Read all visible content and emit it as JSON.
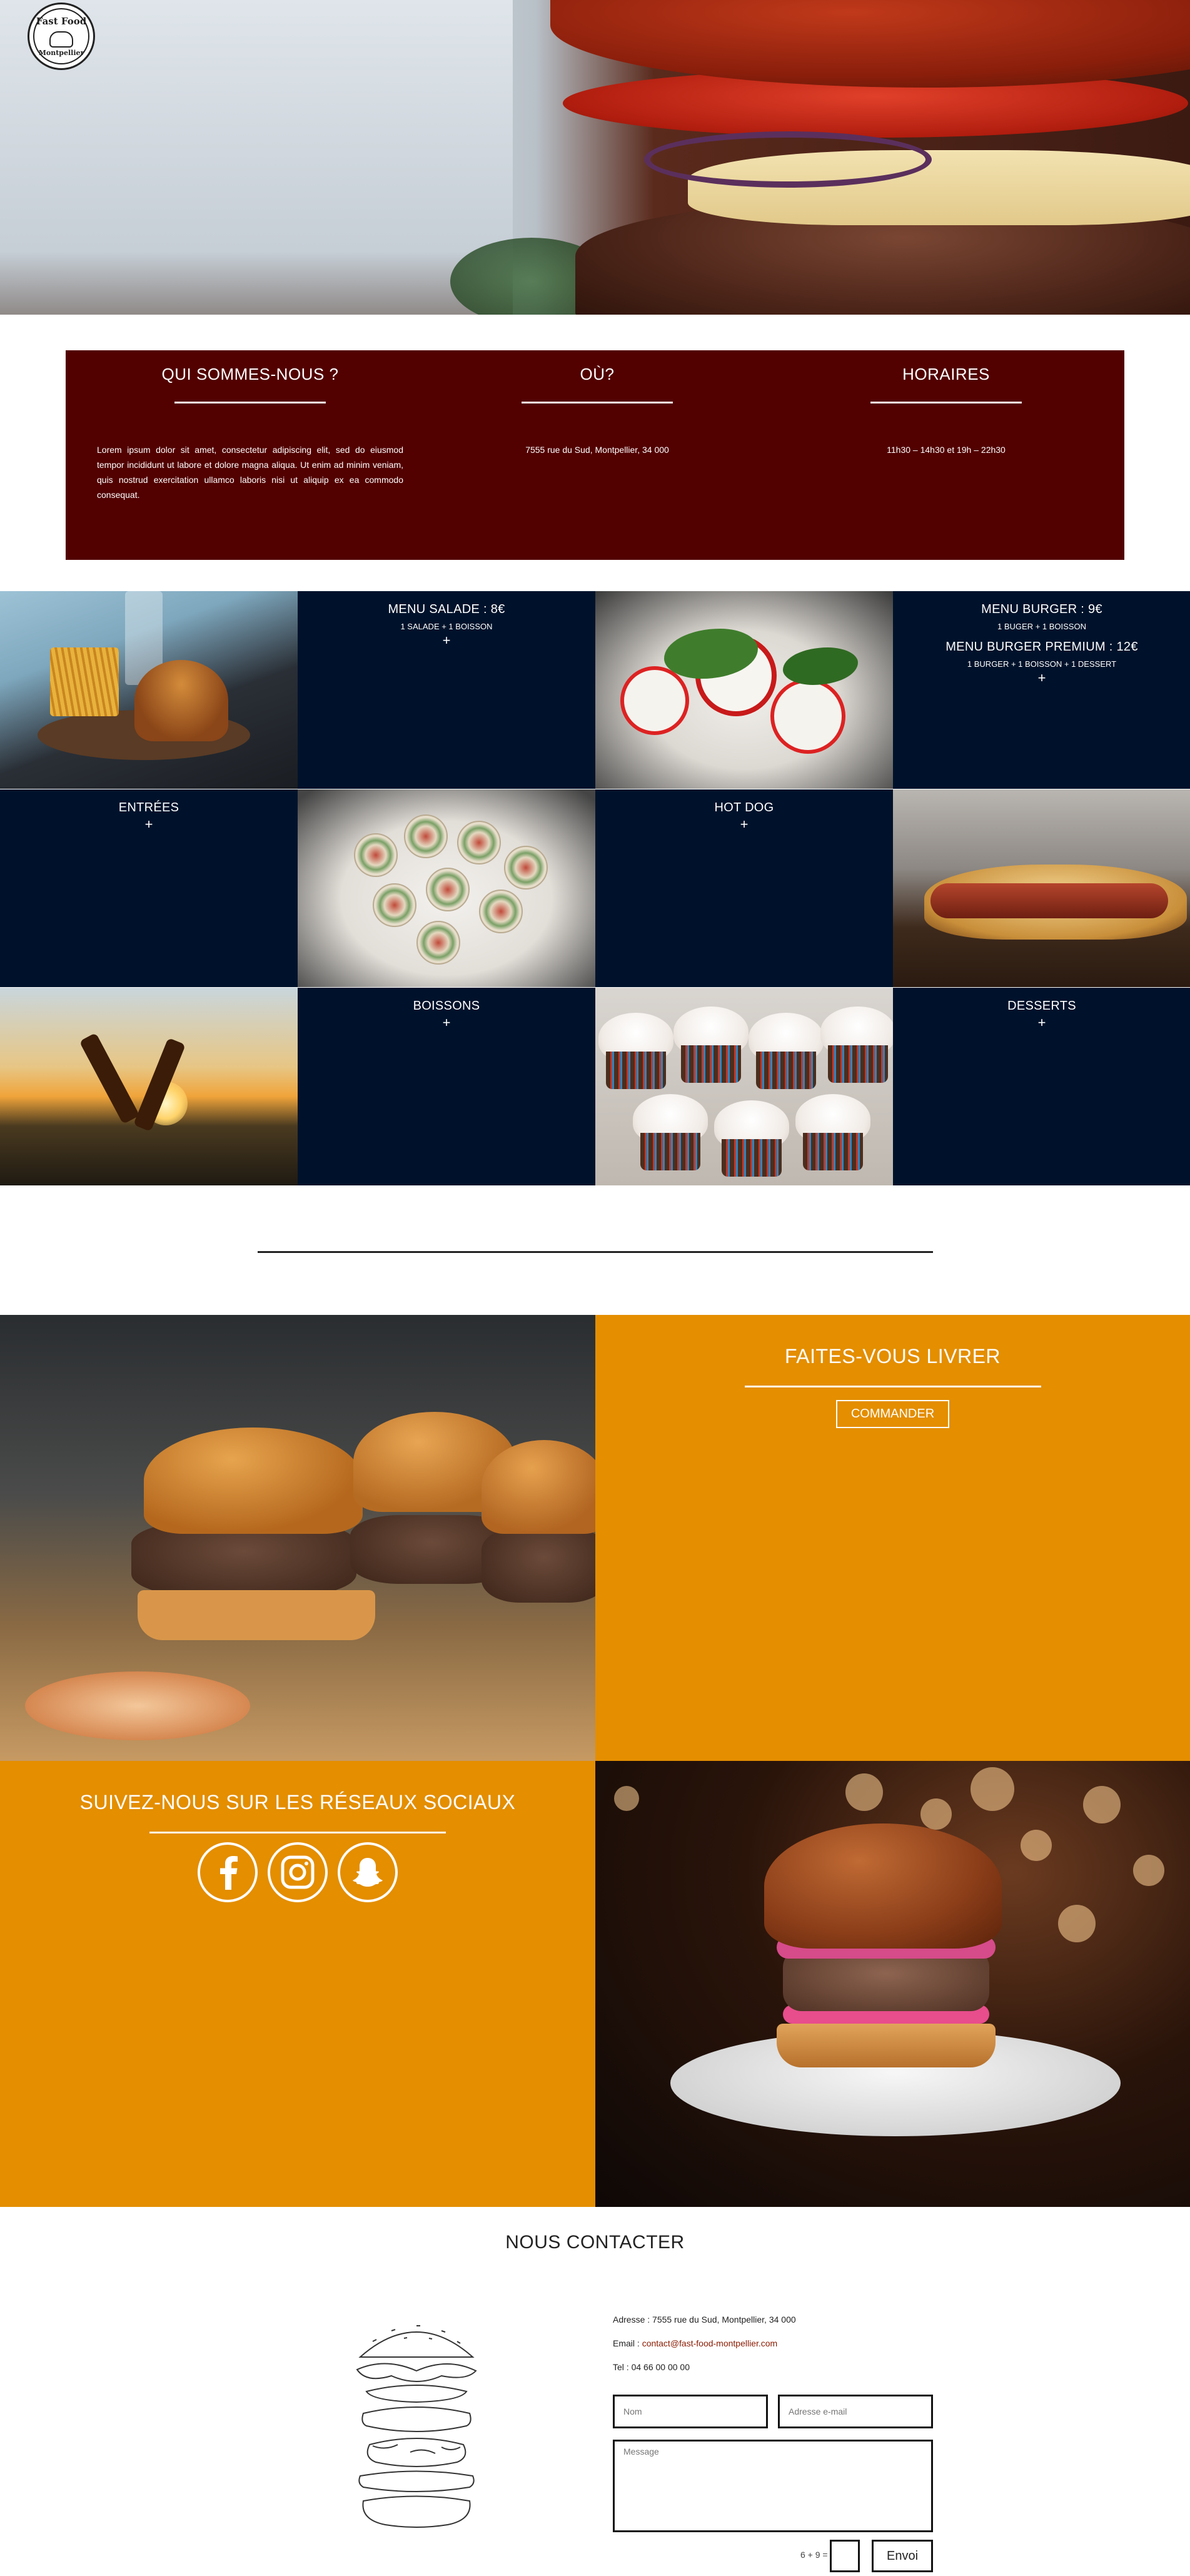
{
  "logo": {
    "line1": "Fast Food",
    "line2": "Montpellier"
  },
  "info": {
    "about": {
      "title": "QUI SOMMES-NOUS ?",
      "text": "Lorem ipsum dolor sit amet, consectetur adipiscing elit, sed do eiusmod tempor incididunt ut labore et dolore magna aliqua. Ut enim ad minim veniam, quis nostrud exercitation ullamco laboris nisi ut aliquip ex ea commodo consequat."
    },
    "where": {
      "title": "OÙ?",
      "text": "7555 rue du Sud, Montpellier, 34 000"
    },
    "hours": {
      "title": "HORAIRES",
      "text": "11h30 – 14h30 et 19h – 22h30"
    }
  },
  "menu": {
    "salade": {
      "title": "MENU SALADE : 8€",
      "sub": "1 SALADE + 1 BOISSON",
      "plus": "+"
    },
    "burger": {
      "title": "MENU BURGER : 9€",
      "sub": "1 BUGER + 1 BOISSON",
      "title2": "MENU BURGER PREMIUM : 12€",
      "sub2": "1 BURGER + 1 BOISSON + 1 DESSERT",
      "plus": "+"
    },
    "entrees": {
      "title": "ENTRÉES",
      "plus": "+"
    },
    "hotdog": {
      "title": "HOT DOG",
      "plus": "+"
    },
    "boissons": {
      "title": "BOISSONS",
      "plus": "+"
    },
    "desserts": {
      "title": "DESSERTS",
      "plus": "+"
    }
  },
  "delivery": {
    "title": "FAITES-VOUS LIVRER",
    "button": "COMMANDER"
  },
  "social": {
    "title": "SUIVEZ-NOUS SUR LES RÉSEAUX SOCIAUX",
    "icons": [
      "facebook-icon",
      "instagram-icon",
      "snapchat-icon"
    ]
  },
  "contact": {
    "title": "NOUS CONTACTER",
    "address_label": "Adresse : 7555 rue du Sud, Montpellier, 34 000",
    "email_label": "Email : ",
    "email": "contact@fast-food-montpellier.com",
    "phone": "Tel : 04 66 00 00 00",
    "name_placeholder": "Nom",
    "email_placeholder": "Adresse e-mail",
    "message_placeholder": "Message",
    "captcha": "6 + 9 =",
    "send": "Envoi"
  },
  "colors": {
    "info_bg": "#520000",
    "menu_bg": "#00122b",
    "orange": "#e48e00",
    "link": "#8a1a00"
  }
}
